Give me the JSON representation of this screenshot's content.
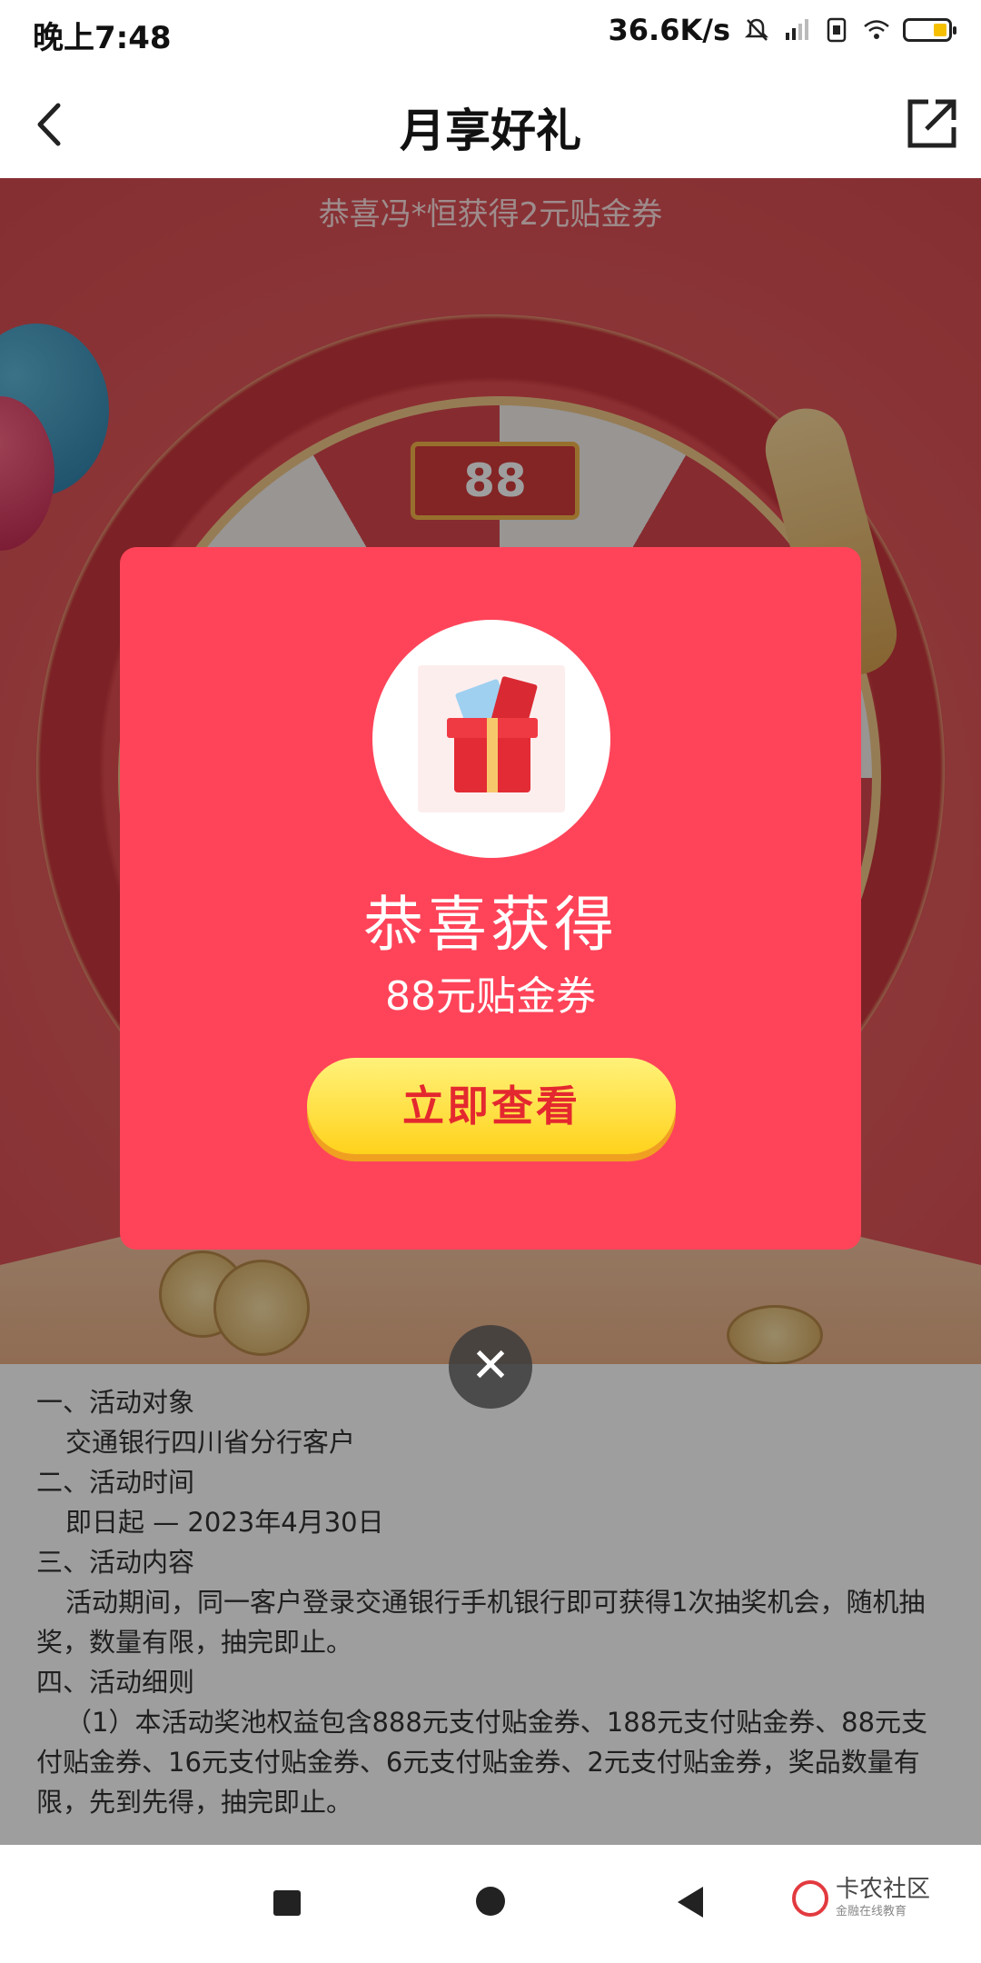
{
  "status_bar": {
    "time": "晚上7:48",
    "network_speed": "36.6K/s",
    "icons": [
      "bell-mute-icon",
      "signal-icon",
      "sim-icon",
      "wifi-icon",
      "battery-icon"
    ],
    "battery_level": 0.3
  },
  "nav": {
    "title": "月享好礼",
    "back_icon": "chevron-left-icon",
    "share_icon": "share-external-icon"
  },
  "banner": {
    "ticker": "恭喜冯*恒获得2元贴金券",
    "wheel_ticket_value": "88"
  },
  "modal": {
    "title": "恭喜获得",
    "prize": "88元贴金券",
    "button_label": "立即查看",
    "close_label": "✕"
  },
  "rules": {
    "lines": [
      "一、活动对象",
      "交通银行四川省分行客户",
      "二、活动时间",
      "即日起 — 2023年4月30日",
      "三、活动内容",
      "活动期间，同一客户登录交通银行手机银行即可获得1次抽奖机会，随机抽奖，数量有限，抽完即止。",
      "四、活动细则",
      "（1）本活动奖池权益包含888元支付贴金券、188元支付贴金券、88元支付贴金券、16元支付贴金券、6元支付贴金券、2元支付贴金券，奖品数量有限，先到先得，抽完即止。"
    ]
  },
  "watermark": {
    "name": "卡农社区",
    "sub": "金融在线教育"
  },
  "colors": {
    "modal_bg": "#ff4459",
    "button_yellow": "#ffd21c",
    "button_text": "#e4282f"
  }
}
